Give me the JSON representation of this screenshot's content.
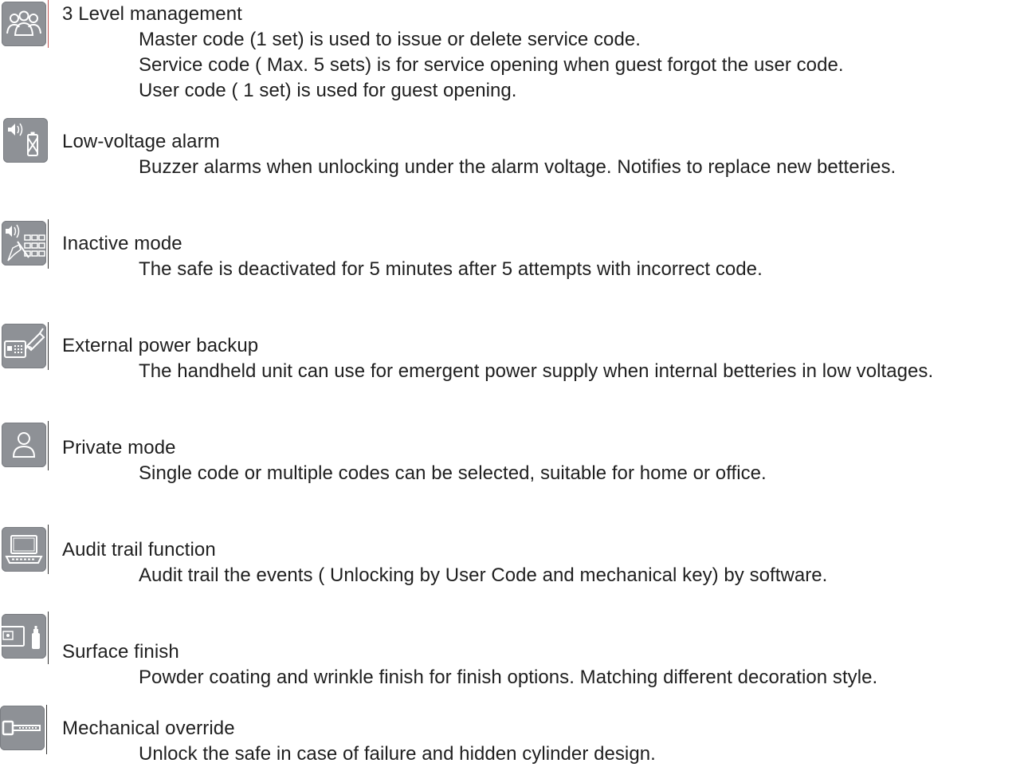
{
  "features": [
    {
      "icon": "people-group-icon",
      "title": "3 Level management",
      "lines": [
        "Master code (1 set) is used to issue or delete service code.",
        "Service code ( Max. 5 sets) is for service opening when guest forgot the user code.",
        "User code ( 1 set) is used for guest opening."
      ]
    },
    {
      "icon": "low-battery-alarm-icon",
      "title": "Low-voltage alarm",
      "lines": [
        "Buzzer alarms when unlocking under the alarm voltage. Notifies to replace new betteries."
      ]
    },
    {
      "icon": "keypad-lockout-icon",
      "title": "Inactive mode",
      "lines": [
        "The safe is deactivated for 5 minutes after 5 attempts with incorrect code."
      ]
    },
    {
      "icon": "external-power-icon",
      "title": "External power backup",
      "lines": [
        "The handheld unit can use for emergent power supply when internal betteries in low voltages."
      ]
    },
    {
      "icon": "person-icon",
      "title": "Private mode",
      "lines": [
        "Single code or multiple codes can be selected, suitable for home or office."
      ]
    },
    {
      "icon": "laptop-icon",
      "title": "Audit trail function",
      "lines": [
        "Audit trail the events ( Unlocking by User Code and mechanical key) by software."
      ]
    },
    {
      "icon": "safe-spray-icon",
      "title": "Surface finish",
      "lines": [
        "Powder coating and wrinkle finish for finish options. Matching different decoration style."
      ]
    },
    {
      "icon": "key-icon",
      "title": "Mechanical override",
      "lines": [
        "Unlock the safe in case of failure and hidden cylinder design."
      ]
    }
  ]
}
